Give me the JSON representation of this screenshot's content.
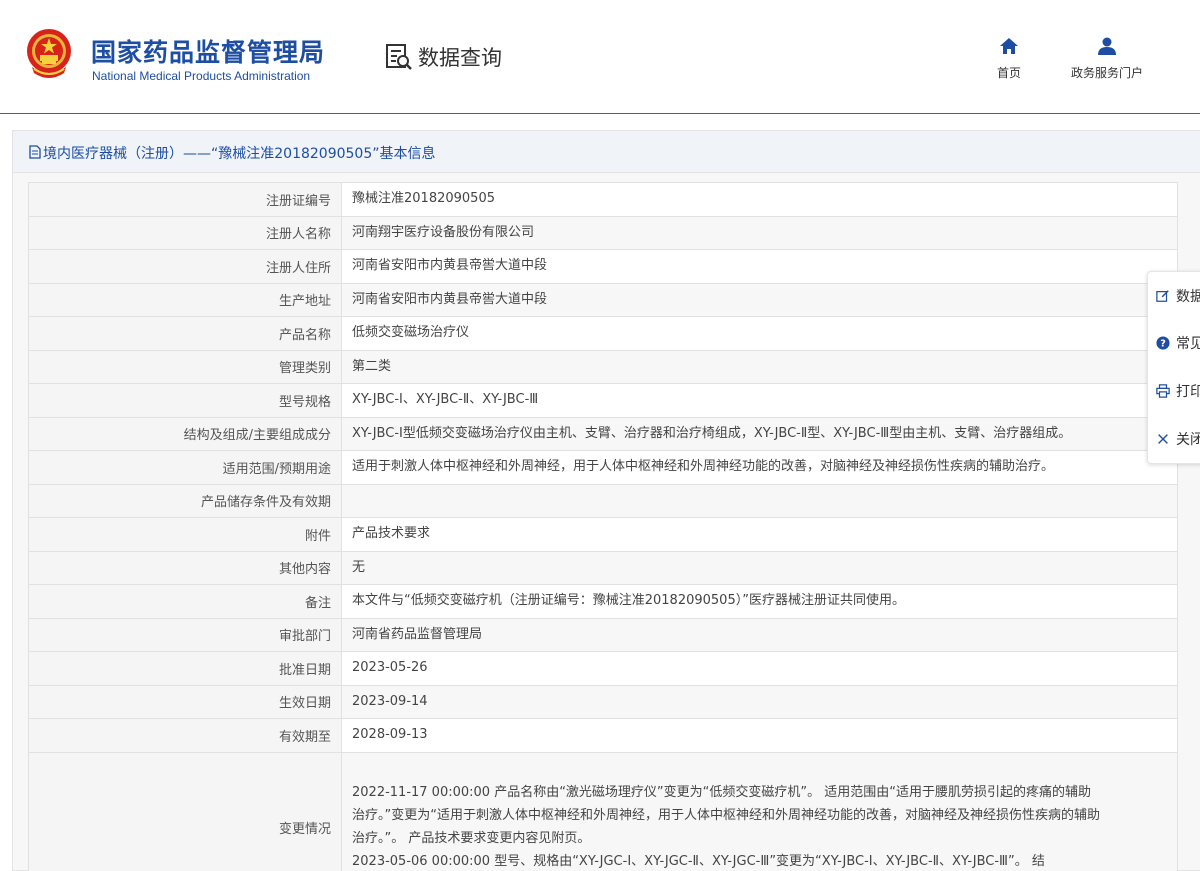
{
  "header": {
    "brand_cn": "国家药品监督管理局",
    "brand_en": "National Medical Products Administration",
    "section_title": "数据查询",
    "nav": [
      {
        "label": "首页",
        "icon": "home-icon"
      },
      {
        "label": "政务服务门户",
        "icon": "user-icon"
      }
    ]
  },
  "panel": {
    "title": "境内医疗器械（注册）——“豫械注准20182090505”基本信息"
  },
  "rows": [
    {
      "label": "注册证编号",
      "value": "豫械注准20182090505"
    },
    {
      "label": "注册人名称",
      "value": "河南翔宇医疗设备股份有限公司"
    },
    {
      "label": "注册人住所",
      "value": "河南省安阳市内黄县帝喾大道中段"
    },
    {
      "label": "生产地址",
      "value": "河南省安阳市内黄县帝喾大道中段"
    },
    {
      "label": "产品名称",
      "value": "低频交变磁场治疗仪"
    },
    {
      "label": "管理类别",
      "value": "第二类"
    },
    {
      "label": "型号规格",
      "value": "XY-JBC-Ⅰ、XY-JBC-Ⅱ、XY-JBC-Ⅲ"
    },
    {
      "label": "结构及组成/主要组成成分",
      "value": "XY-JBC-Ⅰ型低频交变磁场治疗仪由主机、支臂、治疗器和治疗椅组成，XY-JBC-Ⅱ型、XY-JBC-Ⅲ型由主机、支臂、治疗器组成。"
    },
    {
      "label": "适用范围/预期用途",
      "value": "适用于刺激人体中枢神经和外周神经，用于人体中枢神经和外周神经功能的改善，对脑神经及神经损伤性疾病的辅助治疗。"
    },
    {
      "label": "产品储存条件及有效期",
      "value": ""
    },
    {
      "label": "附件",
      "value": "产品技术要求"
    },
    {
      "label": "其他内容",
      "value": "无"
    },
    {
      "label": "备注",
      "value": "本文件与“低频交变磁疗机（注册证编号：豫械注准20182090505）”医疗器械注册证共同使用。"
    },
    {
      "label": "审批部门",
      "value": "河南省药品监督管理局"
    },
    {
      "label": "批准日期",
      "value": "2023-05-26"
    },
    {
      "label": "生效日期",
      "value": "2023-09-14"
    },
    {
      "label": "有效期至",
      "value": "2028-09-13"
    }
  ],
  "change": {
    "label": "变更情况",
    "lines": [
      "2022-11-17 00:00:00 产品名称由“激光磁场理疗仪”变更为“低频交变磁疗机”。 适用范围由“适用于腰肌劳损引起的疼痛的辅助",
      "治疗。”变更为“适用于刺激人体中枢神经和外周神经，用于人体中枢神经和外周神经功能的改善，对脑神经及神经损伤性疾病的辅助",
      "治疗。”。 产品技术要求变更内容见附页。",
      "2023-05-06 00:00:00 型号、规格由“XY-JGC-Ⅰ、XY-JGC-Ⅱ、XY-JGC-Ⅲ”变更为“XY-JBC-Ⅰ、XY-JBC-Ⅱ、XY-JBC-Ⅲ”。 结"
    ]
  },
  "side_toolbar": [
    {
      "label": "数据",
      "icon": "edit-icon"
    },
    {
      "label": "常见",
      "icon": "help-icon"
    },
    {
      "label": "打印",
      "icon": "print-icon"
    },
    {
      "label": "关闭",
      "icon": "close-icon"
    }
  ],
  "colors": {
    "brand_blue": "#1d4ea3",
    "border": "#e1e1e1",
    "label_bg": "#f5f5f5"
  }
}
